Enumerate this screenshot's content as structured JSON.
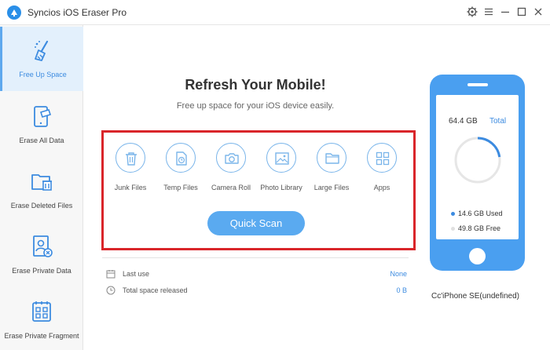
{
  "window": {
    "title": "Syncios iOS Eraser Pro"
  },
  "sidebar": {
    "items": [
      {
        "label": "Free Up Space"
      },
      {
        "label": "Erase All Data"
      },
      {
        "label": "Erase Deleted Files"
      },
      {
        "label": "Erase Private Data"
      },
      {
        "label": "Erase Private Fragment"
      }
    ]
  },
  "main": {
    "title": "Refresh Your Mobile!",
    "subtitle": "Free up space for your iOS device easily.",
    "categories": [
      {
        "label": "Junk Files"
      },
      {
        "label": "Temp Files"
      },
      {
        "label": "Camera Roll"
      },
      {
        "label": "Photo Library"
      },
      {
        "label": "Large Files"
      },
      {
        "label": "Apps"
      }
    ],
    "scan_button": "Quick Scan",
    "info": {
      "last_use_label": "Last use",
      "last_use_value": "None",
      "released_label": "Total space released",
      "released_value": "0 B"
    }
  },
  "device": {
    "total": "64.4 GB",
    "total_label": "Total",
    "used": "14.6 GB",
    "used_label": "Used",
    "free": "49.8 GB",
    "free_label": "Free",
    "used_fraction": 0.227,
    "name": "Cc'iPhone SE(undefined)"
  },
  "colors": {
    "accent": "#5aaaf0",
    "phone": "#4a9ff0",
    "highlight_box": "#d9252a",
    "used": "#3c8be0",
    "free": "#e6e6e6"
  }
}
